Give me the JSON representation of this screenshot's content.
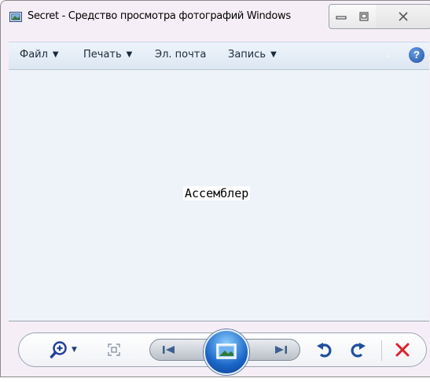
{
  "window": {
    "title": "Secret - Средство просмотра фотографий Windows"
  },
  "menu": {
    "items": [
      {
        "label": "Файл",
        "has_dropdown": true
      },
      {
        "label": "Печать",
        "has_dropdown": true
      },
      {
        "label": "Эл. почта",
        "has_dropdown": false
      },
      {
        "label": "Запись",
        "has_dropdown": true
      }
    ],
    "overflow_icon": "double-chevron-icon",
    "help_glyph": "?"
  },
  "viewer": {
    "photo_text": "Ассемблер",
    "background": "#eef3f9"
  },
  "toolbar": {
    "icons": [
      "zoom-icon",
      "actual-size-icon",
      "previous-icon",
      "slideshow-icon",
      "next-icon",
      "rotate-counterclockwise-icon",
      "rotate-clockwise-icon",
      "delete-icon"
    ]
  },
  "colors": {
    "accent": "#1a66c7",
    "delete": "#d9252a",
    "rotate": "#1f4f9e"
  }
}
